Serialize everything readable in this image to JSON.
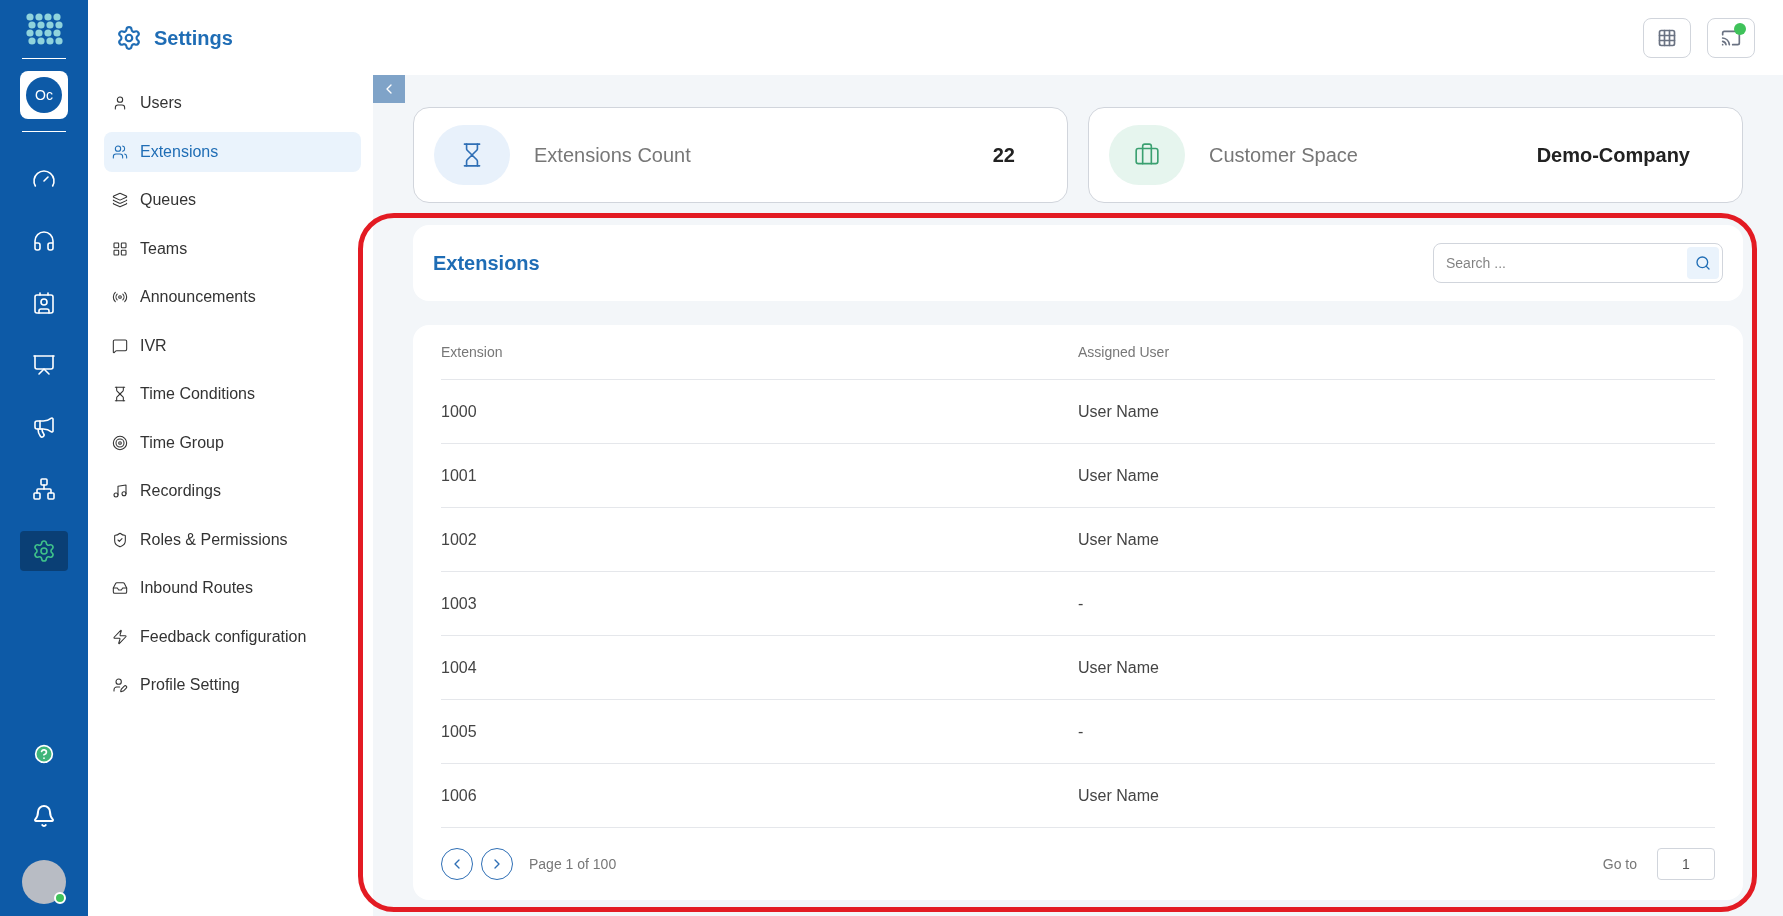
{
  "rail": {
    "items": [
      {
        "kind": "dashboard",
        "selected": false
      },
      {
        "kind": "headset",
        "selected": false
      },
      {
        "kind": "contacts",
        "selected": false
      },
      {
        "kind": "monitor",
        "selected": false
      },
      {
        "kind": "megaphone",
        "selected": false
      },
      {
        "kind": "network",
        "selected": false
      },
      {
        "kind": "settings",
        "selected": true
      }
    ],
    "workspace": "Oc",
    "user_online": true
  },
  "header": {
    "title": "Settings"
  },
  "sidebar": {
    "items": [
      {
        "label": "Users",
        "kind": "user",
        "selected": false
      },
      {
        "label": "Extensions",
        "kind": "users",
        "selected": true
      },
      {
        "label": "Queues",
        "kind": "layers",
        "selected": false
      },
      {
        "label": "Teams",
        "kind": "grid",
        "selected": false
      },
      {
        "label": "Announcements",
        "kind": "radio",
        "selected": false
      },
      {
        "label": "IVR",
        "kind": "message",
        "selected": false
      },
      {
        "label": "Time Conditions",
        "kind": "hourglass",
        "selected": false
      },
      {
        "label": "Time Group",
        "kind": "target",
        "selected": false
      },
      {
        "label": "Recordings",
        "kind": "music",
        "selected": false
      },
      {
        "label": "Roles & Permissions",
        "kind": "shield",
        "selected": false
      },
      {
        "label": "Inbound Routes",
        "kind": "inbox",
        "selected": false
      },
      {
        "label": "Feedback configuration",
        "kind": "zap",
        "selected": false
      },
      {
        "label": "Profile Setting",
        "kind": "userpen",
        "selected": false
      }
    ]
  },
  "stats": [
    {
      "label": "Extensions Count",
      "value": "22",
      "kind": "hourglass"
    },
    {
      "label": "Customer Space",
      "value": "Demo-Company",
      "kind": "briefcase"
    }
  ],
  "panel": {
    "title": "Extensions",
    "search": {
      "placeholder": "Search ..."
    }
  },
  "table": {
    "columns": [
      "Extension",
      "Assigned User"
    ],
    "rows": [
      [
        "1000",
        "User Name"
      ],
      [
        "1001",
        "User Name"
      ],
      [
        "1002",
        "User Name"
      ],
      [
        "1003",
        "-"
      ],
      [
        "1004",
        "User Name"
      ],
      [
        "1005",
        "-"
      ],
      [
        "1006",
        "User Name"
      ]
    ]
  },
  "pagination": {
    "page_text": "Page 1 of 100",
    "goto_label": "Go to",
    "goto_value": "1"
  }
}
